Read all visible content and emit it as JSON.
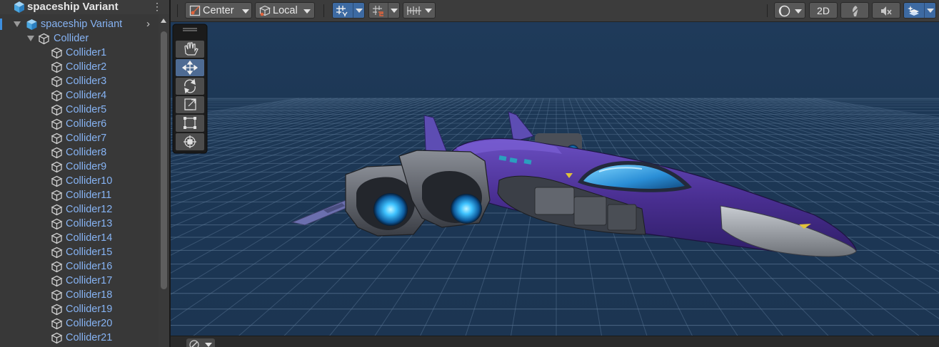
{
  "hierarchy": {
    "title": "spaceship Variant",
    "menu_icon": "kebab-menu-icon",
    "root": {
      "label": "spaceship Variant",
      "icon": "prefab-cube-icon"
    },
    "group": {
      "label": "Collider",
      "icon": "gameobject-cube-icon"
    },
    "children": [
      "Collider1",
      "Collider2",
      "Collider3",
      "Collider4",
      "Collider5",
      "Collider6",
      "Collider7",
      "Collider8",
      "Collider9",
      "Collider10",
      "Collider11",
      "Collider12",
      "Collider13",
      "Collider14",
      "Collider15",
      "Collider16",
      "Collider17",
      "Collider18",
      "Collider19",
      "Collider20",
      "Collider21"
    ],
    "label_color": "#86b3f3"
  },
  "scene_toolbar": {
    "pivot_label": "Center",
    "rotation_label": "Local",
    "mode_2d_label": "2D"
  },
  "tools": [
    "hand-tool",
    "move-tool",
    "rotate-tool",
    "scale-tool",
    "rect-tool",
    "transform-tool"
  ],
  "selected_tool": "move-tool",
  "colors": {
    "sky": "#1f3a59",
    "accent": "#3d6aa2",
    "link_blue": "#86b3f3"
  }
}
